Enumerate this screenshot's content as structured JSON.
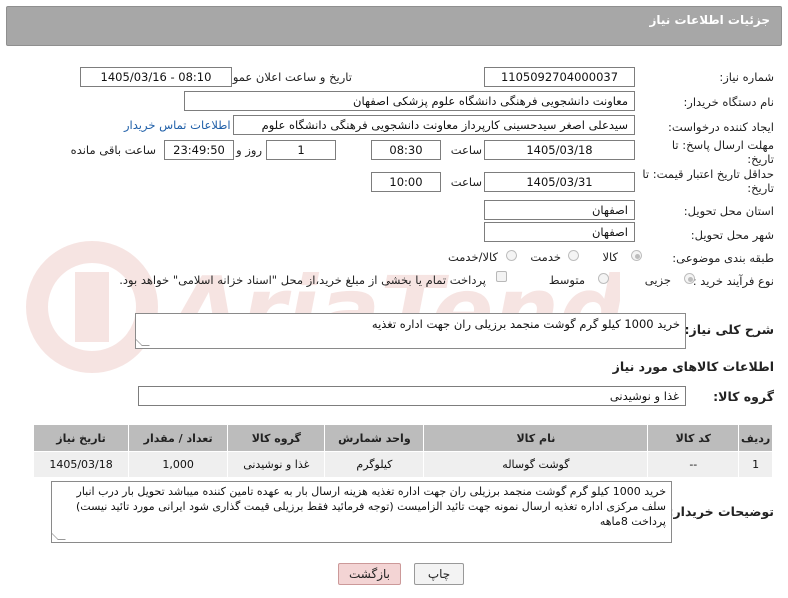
{
  "header": {
    "title": "جزئیات اطلاعات نیاز"
  },
  "labels": {
    "need_number": "شماره نیاز:",
    "announce_datetime": "تاریخ و ساعت اعلان عمومی:",
    "buyer_org": "نام دستگاه خریدار:",
    "requester": "ایجاد کننده درخواست:",
    "reply_deadline": "مهلت ارسال پاسخ: تا تاریخ:",
    "hour": "ساعت",
    "day_and": "روز و",
    "time_remaining": "ساعت باقی مانده",
    "price_validity": "حداقل تاریخ اعتبار قیمت: تا تاریخ:",
    "province": "استان محل تحویل:",
    "city": "شهر محل تحویل:",
    "category": "طبقه بندی موضوعی:",
    "process_type": "نوع فرآیند خرید :",
    "general_desc": "شرح کلی نیاز:",
    "goods_info": "اطلاعات کالاهای مورد نیاز",
    "goods_group": "گروه کالا:",
    "buyer_notes": "توضیحات خریدار:"
  },
  "fields": {
    "need_number": "1105092704000037",
    "announce_datetime": "1405/03/16 - 08:10",
    "buyer_org": "معاونت دانشجویی فرهنگی دانشگاه علوم پزشکی اصفهان",
    "requester": "سیدعلی اصغر سیدحسینی کارپرداز معاونت دانشجویی فرهنگی دانشگاه علوم",
    "contact_link": "اطلاعات تماس خریدار",
    "reply_date": "1405/03/18",
    "reply_time": "08:30",
    "days": "1",
    "remaining": "23:49:50",
    "validity_date": "1405/03/31",
    "validity_time": "10:00",
    "province": "اصفهان",
    "city": "اصفهان",
    "general_desc": "خرید 1000 کیلو گرم گوشت منجمد برزیلی ران  جهت اداره تغذیه",
    "goods_group": "غذا و نوشیدنی",
    "buyer_notes": "خرید 1000 کیلو گرم گوشت منجمد برزیلی ران  جهت اداره تغذیه هزینه ارسال بار به عهده تامین کننده میباشد تحویل بار درب انبار سلف مرکزی اداره تغذیه ارسال نمونه جهت تائید الزامیست (توجه فرمائید فقط برزیلی قیمت گذاری شود ایرانی مورد تائید نیست) پرداخت 8ماهه"
  },
  "category_options": {
    "goods": "کالا",
    "service": "خدمت",
    "goods_service": "کالا/خدمت",
    "selected": "کالا"
  },
  "process_options": {
    "partial": "جزیی",
    "medium": "متوسط",
    "selected": "جزیی",
    "payment_note": "پرداخت تمام یا بخشی از مبلغ خرید،از محل \"اسناد خزانه اسلامی\" خواهد بود."
  },
  "table": {
    "headers": [
      "ردیف",
      "کد کالا",
      "نام کالا",
      "واحد شمارش",
      "گروه کالا",
      "تعداد / مقدار",
      "تاریخ نیاز"
    ],
    "rows": [
      [
        "1",
        "--",
        "گوشت گوساله",
        "کیلوگرم",
        "غذا و نوشیدنی",
        "1,000",
        "1405/03/18"
      ]
    ]
  },
  "buttons": {
    "print": "چاپ",
    "back": "بازگشت"
  },
  "watermark": {
    "text": "AriaTender.neT"
  },
  "colors": {
    "header_bg": "#a7a7a7",
    "link": "#1f5fa8",
    "back_btn_bg": "#f3d4d4",
    "watermark": "#c0392b"
  }
}
